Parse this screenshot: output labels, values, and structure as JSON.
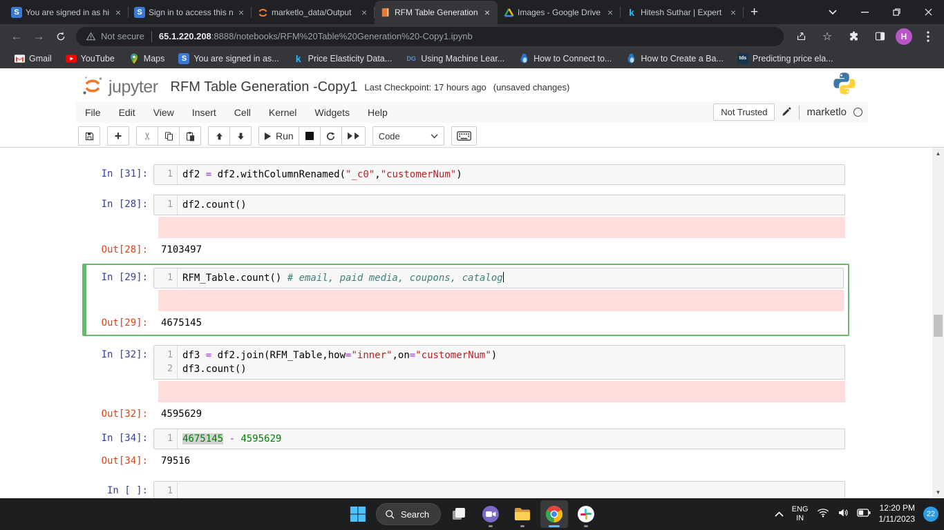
{
  "browser": {
    "tabs": [
      {
        "title": "You are signed in as hi",
        "favicon": "slack"
      },
      {
        "title": "Sign in to access this n",
        "favicon": "slack"
      },
      {
        "title": "marketlo_data/Output",
        "favicon": "jupyter"
      },
      {
        "title": "RFM Table Generation",
        "favicon": "notebook"
      },
      {
        "title": "Images - Google Drive",
        "favicon": "drive"
      },
      {
        "title": "Hitesh Suthar | Expert",
        "favicon": "kaggle"
      }
    ],
    "address": {
      "security_label": "Not secure",
      "url_host": "65.1.220.208",
      "url_rest": ":8888/notebooks/RFM%20Table%20Generation%20-Copy1.ipynb"
    },
    "profile_initial": "H",
    "bookmarks": [
      {
        "label": "Gmail"
      },
      {
        "label": "YouTube"
      },
      {
        "label": "Maps"
      },
      {
        "label": "You are signed in as..."
      },
      {
        "label": "Price Elasticity Data..."
      },
      {
        "label": "Using Machine Lear..."
      },
      {
        "label": "How to Connect to..."
      },
      {
        "label": "How to Create a Ba..."
      },
      {
        "label": "Predicting price ela..."
      }
    ]
  },
  "jupyter": {
    "logo_text": "jupyter",
    "title": "RFM Table Generation -Copy1",
    "checkpoint": "Last Checkpoint: 17 hours ago",
    "unsaved": "(unsaved changes)",
    "menus": [
      "File",
      "Edit",
      "View",
      "Insert",
      "Cell",
      "Kernel",
      "Widgets",
      "Help"
    ],
    "trust_label": "Not Trusted",
    "kernel_name": "marketlo",
    "toolbar": {
      "run_label": "Run",
      "cell_type": "Code"
    }
  },
  "cells": [
    {
      "prompt": "In [31]:",
      "lines": [
        {
          "num": "1",
          "tokens": [
            {
              "t": "df2 ",
              "c": "p"
            },
            {
              "t": "=",
              "c": "op"
            },
            {
              "t": " df2.withColumnRenamed(",
              "c": "p"
            },
            {
              "t": "\"_c0\"",
              "c": "s"
            },
            {
              "t": ",",
              "c": "p"
            },
            {
              "t": "\"customerNum\"",
              "c": "s"
            },
            {
              "t": ")",
              "c": "p"
            }
          ]
        }
      ]
    },
    {
      "prompt": "In [28]:",
      "lines": [
        {
          "num": "1",
          "tokens": [
            {
              "t": "df2.count()",
              "c": "p"
            }
          ]
        }
      ],
      "out_prompt": "Out[28]:",
      "out_value": "7103497"
    },
    {
      "prompt": "In [29]:",
      "lines": [
        {
          "num": "1",
          "tokens": [
            {
              "t": "RFM_Table.count() ",
              "c": "p"
            },
            {
              "t": "# email, paid media, coupons, catalog",
              "c": "c"
            }
          ]
        }
      ],
      "out_prompt": "Out[29]:",
      "out_value": "4675145"
    },
    {
      "prompt": "In [32]:",
      "lines": [
        {
          "num": "1",
          "tokens": [
            {
              "t": "df3 ",
              "c": "p"
            },
            {
              "t": "=",
              "c": "op"
            },
            {
              "t": " df2.join(RFM_Table,how",
              "c": "p"
            },
            {
              "t": "=",
              "c": "op"
            },
            {
              "t": "\"inner\"",
              "c": "s"
            },
            {
              "t": ",on",
              "c": "p"
            },
            {
              "t": "=",
              "c": "op"
            },
            {
              "t": "\"customerNum\"",
              "c": "s"
            },
            {
              "t": ")",
              "c": "p"
            }
          ]
        },
        {
          "num": "2",
          "tokens": [
            {
              "t": "df3.count()",
              "c": "p"
            }
          ]
        }
      ],
      "out_prompt": "Out[32]:",
      "out_value": "4595629"
    },
    {
      "prompt": "In [34]:",
      "lines": [
        {
          "num": "1",
          "tokens": [
            {
              "t": "4675145",
              "c": "n",
              "hl": true
            },
            {
              "t": " ",
              "c": "p"
            },
            {
              "t": "-",
              "c": "op"
            },
            {
              "t": " ",
              "c": "p"
            },
            {
              "t": "4595629",
              "c": "n"
            }
          ]
        }
      ],
      "out_prompt": "Out[34]:",
      "out_value": "79516"
    },
    {
      "prompt": "In [ ]:",
      "lines": [
        {
          "num": "1",
          "tokens": []
        }
      ]
    }
  ],
  "taskbar": {
    "search_label": "Search",
    "lang_line1": "ENG",
    "lang_line2": "IN",
    "time": "12:20 PM",
    "date": "1/11/2023",
    "badge_count": "22"
  },
  "colors": {
    "jupyter_orange": "#F37726",
    "selected_cell_green": "#66bb6a",
    "in_prompt": "#303F9F",
    "out_prompt": "#D84315",
    "stderr_bg": "#ffdddd",
    "chrome_dark": "#202124",
    "chrome_toolbar": "#35363a"
  }
}
